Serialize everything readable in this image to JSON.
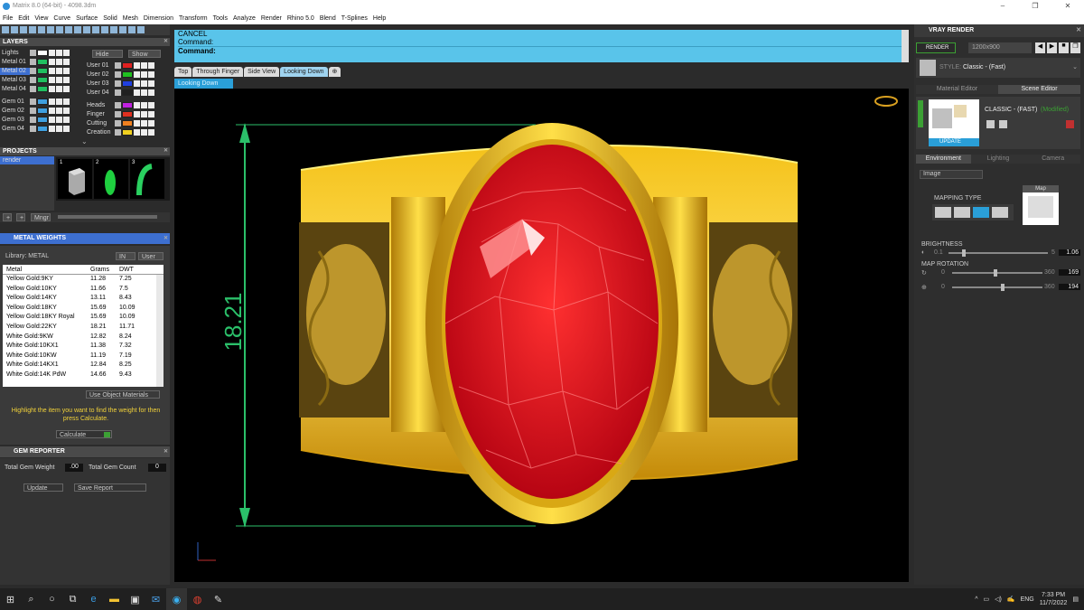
{
  "window": {
    "title": "Matrix 8.0 (64-bit) - 4098.3dm"
  },
  "menu": [
    "File",
    "Edit",
    "View",
    "Curve",
    "Surface",
    "Solid",
    "Mesh",
    "Dimension",
    "Transform",
    "Tools",
    "Analyze",
    "Render",
    "Rhino 5.0",
    "Blend",
    "T-Splines",
    "Help"
  ],
  "layers": {
    "title": "LAYERS",
    "hide": "Hide",
    "show": "Show",
    "left": [
      {
        "name": "Lights",
        "color": "#ffffff",
        "sel": false
      },
      {
        "name": "Metal 01",
        "color": "#20c060",
        "sel": false
      },
      {
        "name": "Metal 02",
        "color": "#20c060",
        "sel": true
      },
      {
        "name": "Metal 03",
        "color": "#20c060",
        "sel": false
      },
      {
        "name": "Metal 04",
        "color": "#20c060",
        "sel": false
      },
      {
        "name": "Gem 01",
        "color": "#3fa0e0",
        "sel": false
      },
      {
        "name": "Gem 02",
        "color": "#3fa0e0",
        "sel": false
      },
      {
        "name": "Gem 03",
        "color": "#3fa0e0",
        "sel": false
      },
      {
        "name": "Gem 04",
        "color": "#3fa0e0",
        "sel": false
      }
    ],
    "right": [
      {
        "name": "User 01",
        "color": "#e02020"
      },
      {
        "name": "User 02",
        "color": "#20c020"
      },
      {
        "name": "User 03",
        "color": "#2040e0"
      },
      {
        "name": "User 04",
        "color": "#202020"
      },
      {
        "name": "Heads",
        "color": "#c020e0"
      },
      {
        "name": "Finger",
        "color": "#e03020"
      },
      {
        "name": "Cutting",
        "color": "#f08020"
      },
      {
        "name": "Creation",
        "color": "#f0d020"
      }
    ]
  },
  "projects": {
    "title": "PROJECTS",
    "item": "render",
    "thumb_nums": [
      "1",
      "2",
      "3"
    ],
    "mngr": "Mngr"
  },
  "metal_weights": {
    "title": "METAL WEIGHTS",
    "library": "Library: METAL",
    "mat": "IN",
    "user": "User",
    "headers": [
      "Metal",
      "Grams",
      "DWT"
    ],
    "rows": [
      [
        "Yellow Gold:9KY",
        "11.28",
        "7.25"
      ],
      [
        "Yellow Gold:10KY",
        "11.66",
        "7.5"
      ],
      [
        "Yellow Gold:14KY",
        "13.11",
        "8.43"
      ],
      [
        "Yellow Gold:18KY",
        "15.69",
        "10.09"
      ],
      [
        "Yellow Gold:18KY Royal",
        "15.69",
        "10.09"
      ],
      [
        "Yellow Gold:22KY",
        "18.21",
        "11.71"
      ],
      [
        "White Gold:9KW",
        "12.82",
        "8.24"
      ],
      [
        "White Gold:10KX1",
        "11.38",
        "7.32"
      ],
      [
        "White Gold:10KW",
        "11.19",
        "7.19"
      ],
      [
        "White Gold:14KX1",
        "12.84",
        "8.25"
      ],
      [
        "White Gold:14K PdW",
        "14.66",
        "9.43"
      ]
    ],
    "use_object": "Use Object Materials",
    "hint": "Highlight the item you want to find the weight for then press Calculate.",
    "calculate": "Calculate"
  },
  "gem_reporter": {
    "title": "GEM REPORTER",
    "total_weight_label": "Total Gem Weight",
    "total_weight": ".00",
    "total_count_label": "Total Gem Count",
    "total_count": "0",
    "update": "Update",
    "save": "Save Report"
  },
  "command": {
    "line1": "CANCEL",
    "line2": "Command:",
    "prompt": "Command:"
  },
  "view_tabs": [
    "Top",
    "Through Finger",
    "Side View",
    "Looking Down"
  ],
  "active_view": "Looking Down",
  "dimension": "18.21",
  "vray": {
    "title": "VRAY RENDER",
    "render": "RENDER",
    "resolution": "1200x900",
    "style_label": "STYLE:",
    "style": "Classic - (Fast)",
    "tabs": [
      "Material Editor",
      "Scene Editor"
    ],
    "preset": "CLASSIC - (FAST)",
    "modified": "(Modified)",
    "update": "UPDATE",
    "env_tabs": [
      "Environment",
      "Lighting",
      "Camera"
    ],
    "env_type": "Image",
    "mapping_type": "MAPPING TYPE",
    "map": "Map",
    "brightness_label": "BRIGHTNESS",
    "b_min": "0.1",
    "b_max": "5",
    "brightness": "1.06",
    "rotation_label": "MAP ROTATION",
    "r1_min": "0",
    "r1_max": "360",
    "r1": "169",
    "r2_min": "0",
    "r2_max": "360",
    "r2": "194"
  },
  "taskbar": {
    "lang": "ENG",
    "time": "7:33 PM",
    "date": "11/7/2022"
  }
}
